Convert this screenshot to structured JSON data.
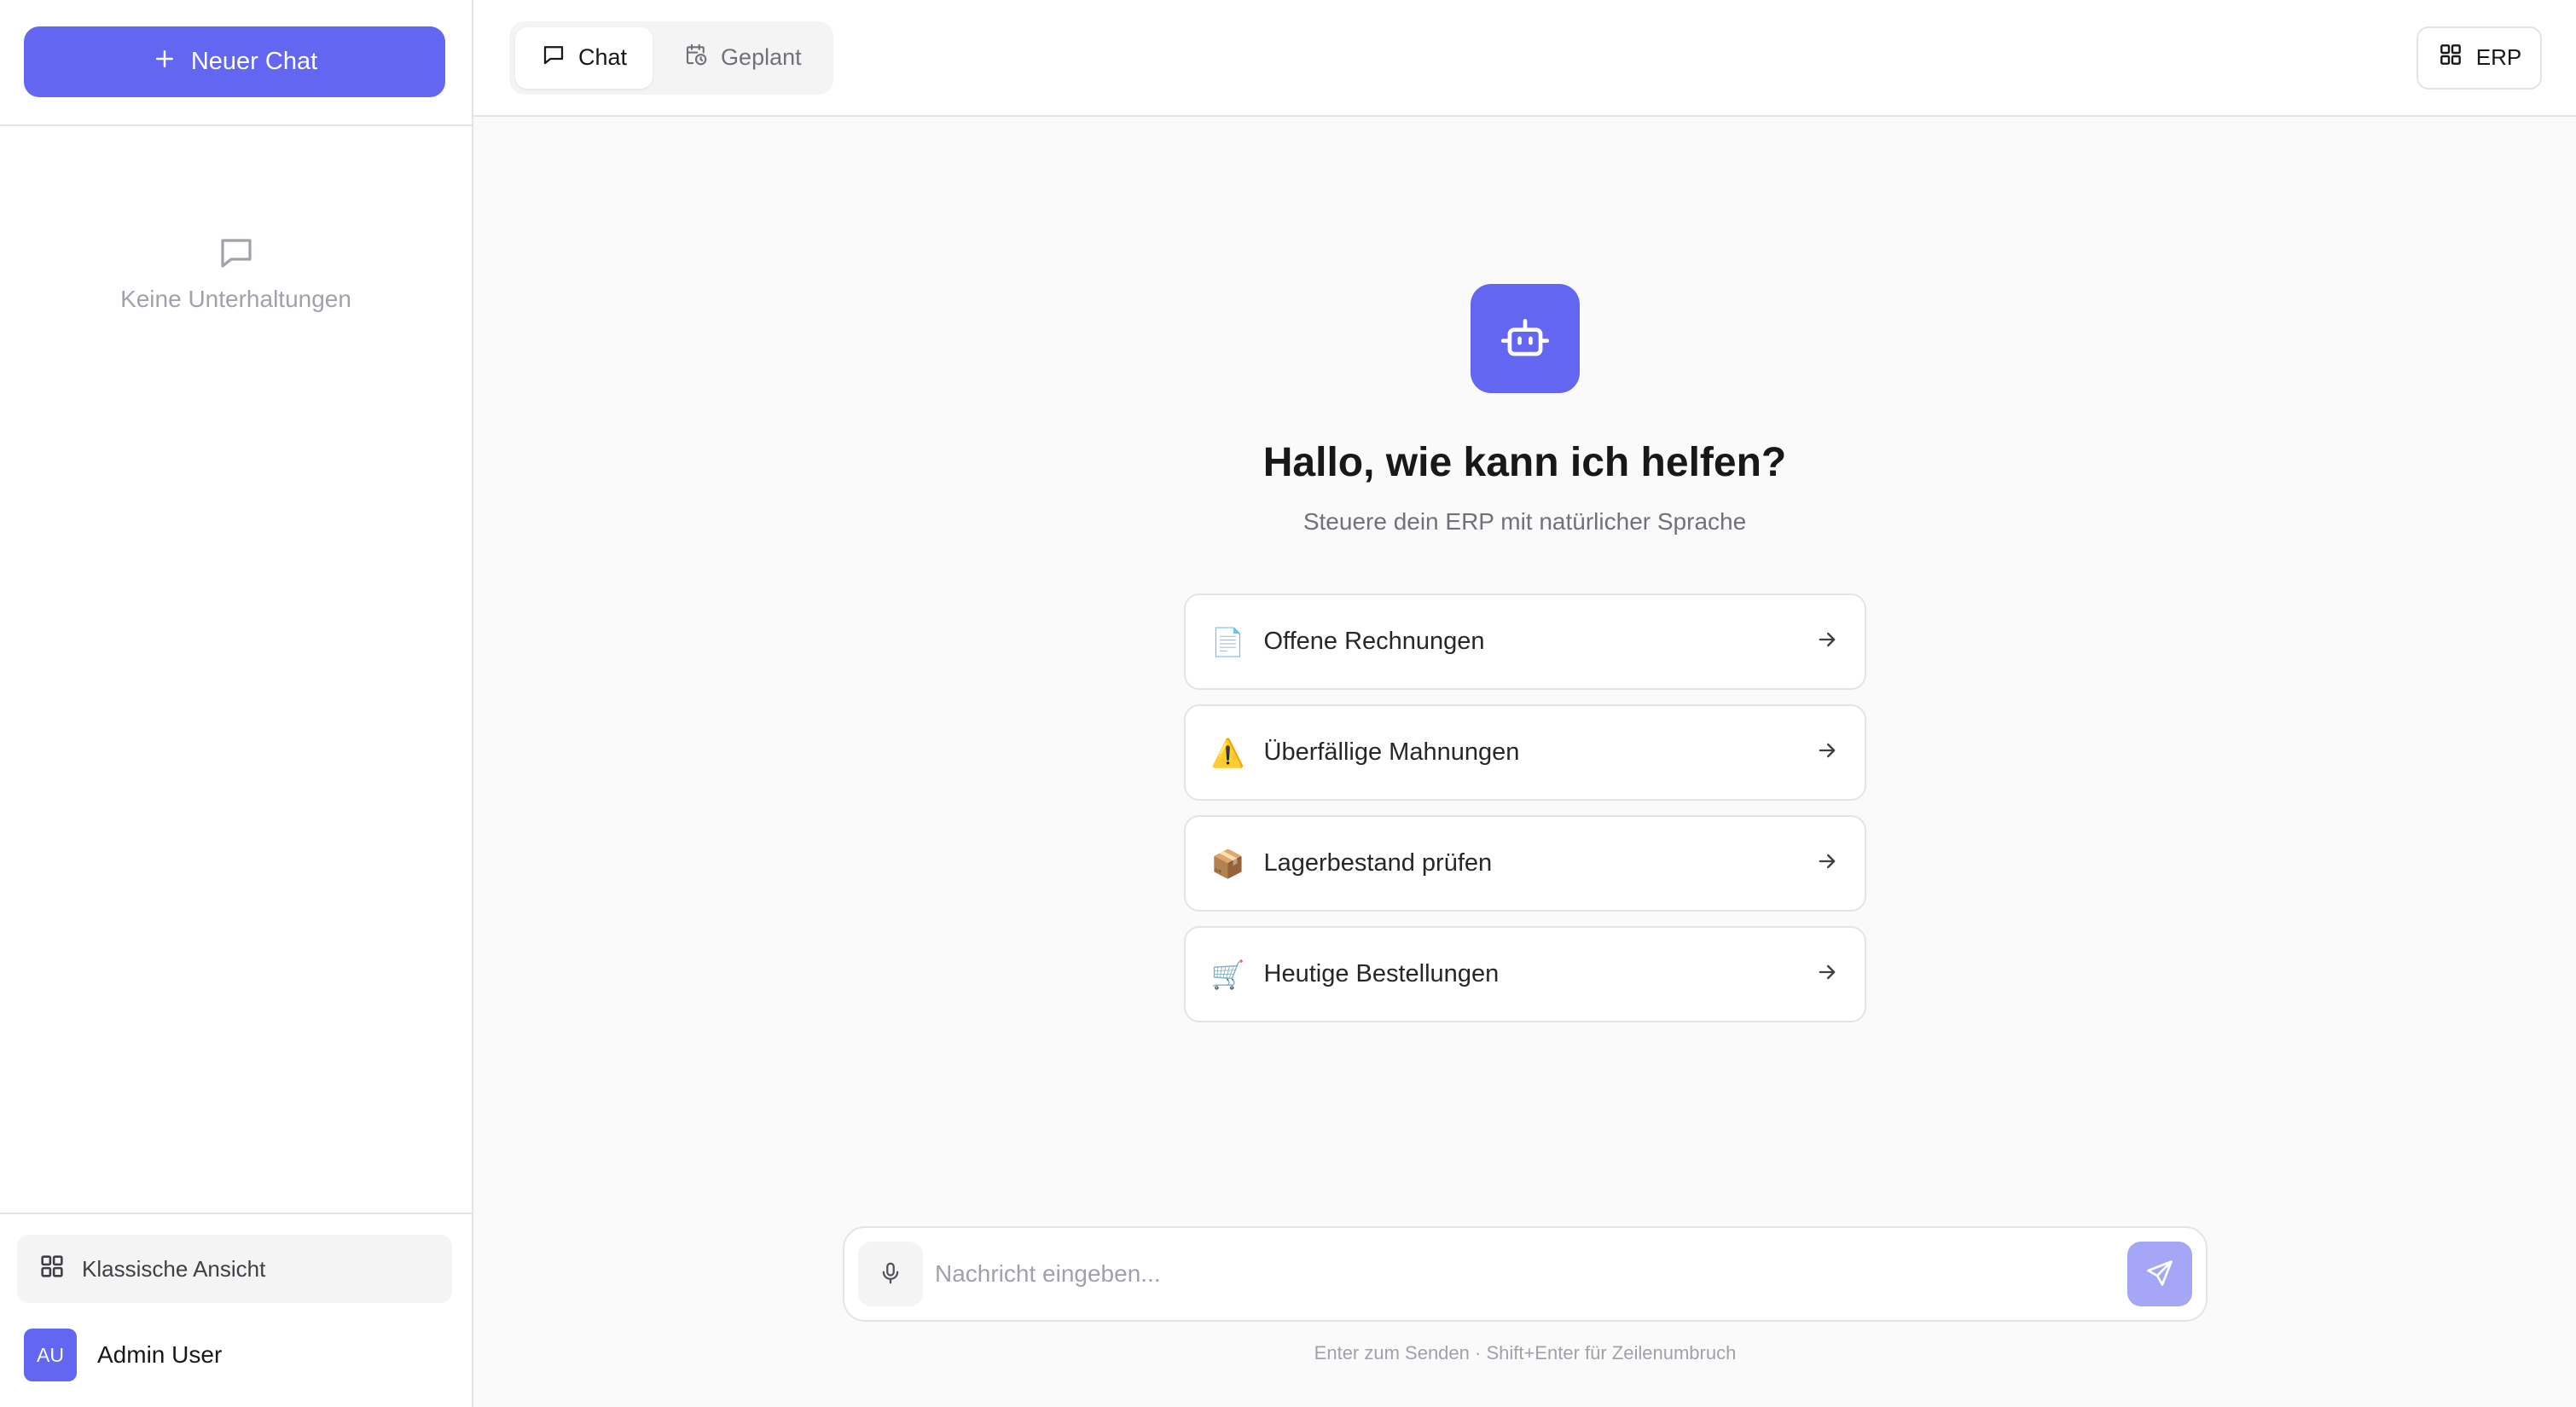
{
  "sidebar": {
    "new_chat_label": "Neuer Chat",
    "empty_text": "Keine Unterhaltungen",
    "classic_view_label": "Klassische Ansicht",
    "user": {
      "initials": "AU",
      "name": "Admin User"
    }
  },
  "topbar": {
    "tabs": [
      {
        "label": "Chat",
        "icon": "chat-bubble-icon",
        "active": true
      },
      {
        "label": "Geplant",
        "icon": "calendar-clock-icon",
        "active": false
      }
    ],
    "erp_label": "ERP"
  },
  "welcome": {
    "title": "Hallo, wie kann ich helfen?",
    "subtitle": "Steuere dein ERP mit natürlicher Sprache"
  },
  "suggestions": [
    {
      "emoji": "📄",
      "label": "Offene Rechnungen"
    },
    {
      "emoji": "⚠️",
      "label": "Überfällige Mahnungen"
    },
    {
      "emoji": "📦",
      "label": "Lagerbestand prüfen"
    },
    {
      "emoji": "🛒",
      "label": "Heutige Bestellungen"
    }
  ],
  "composer": {
    "placeholder": "Nachricht eingeben...",
    "hint": "Enter zum Senden · Shift+Enter für Zeilenumbruch"
  },
  "colors": {
    "accent": "#6366f1",
    "accent_disabled": "#a5a6f6",
    "border": "#e4e4e7",
    "muted_text": "#71717a"
  }
}
